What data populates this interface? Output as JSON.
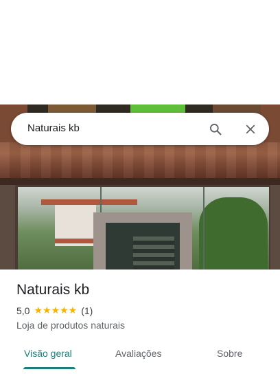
{
  "search": {
    "query": "Naturais kb"
  },
  "place": {
    "name": "Naturais kb",
    "rating": "5,0",
    "stars": "★★★★★",
    "review_count": "(1)",
    "category": "Loja de produtos naturais"
  },
  "tabs": [
    {
      "label": "Visão geral",
      "active": true
    },
    {
      "label": "Avaliações",
      "active": false
    },
    {
      "label": "Sobre",
      "active": false
    }
  ],
  "colors": {
    "accent": "#1b7f79",
    "stars": "#f4b400"
  }
}
